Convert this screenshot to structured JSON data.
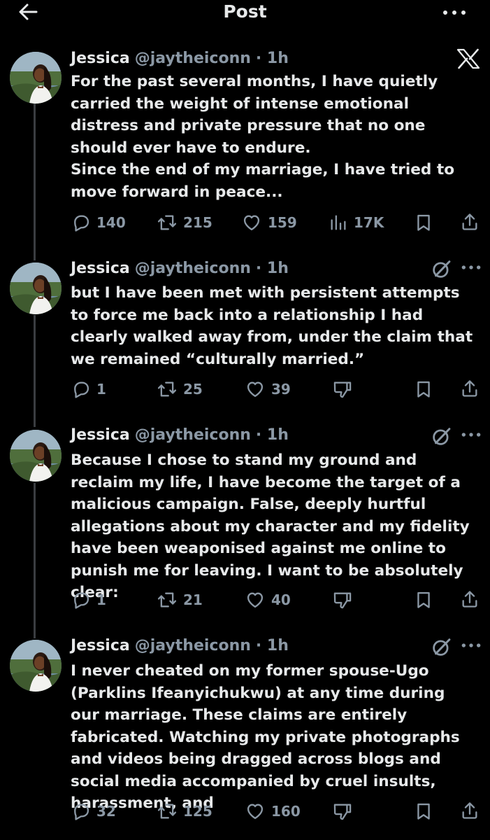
{
  "header": {
    "title": "Post"
  },
  "posts": [
    {
      "name": "Jessica",
      "handle": "@jaytheiconn",
      "time": "· 1h",
      "text": [
        "For the past several months, I have quietly carried the weight of intense emotional distress and private pressure that no one should ever have to endure.",
        "Since the end of my marriage, I have tried to move forward in peace..."
      ],
      "replies": "140",
      "reposts": "215",
      "likes": "159",
      "views": "17K"
    },
    {
      "name": "Jessica",
      "handle": "@jaytheiconn",
      "time": "· 1h",
      "text": [
        "but I have been met with persistent attempts to force me back into a relationship I had clearly walked away from, under the claim that we remained “culturally married.”"
      ],
      "replies": "1",
      "reposts": "25",
      "likes": "39"
    },
    {
      "name": "Jessica",
      "handle": "@jaytheiconn",
      "time": "· 1h",
      "text": [
        "Because I chose to stand my ground and reclaim my life, I have become the target of a malicious campaign. False, deeply hurtful allegations about my character and my fidelity have been weaponised against me online to punish me for leaving. I want to be absolutely clear:"
      ],
      "replies": "1",
      "reposts": "21",
      "likes": "40"
    },
    {
      "name": "Jessica",
      "handle": "@jaytheiconn",
      "time": "· 1h",
      "text": [
        "I never cheated on my former spouse-Ugo (Parklins Ifeanyichukwu) at any time during our marriage. These claims are entirely fabricated. Watching my private photographs and videos being dragged across blogs and social media accompanied by cruel insults, harassment, and"
      ],
      "replies": "32",
      "reposts": "125",
      "likes": "160"
    }
  ],
  "icons": {
    "back": "arrow-left-icon",
    "more": "more-horizontal-icon",
    "x_logo": "x-logo-icon",
    "grok": "grok-icon",
    "reply": "reply-icon",
    "repost": "repost-icon",
    "like": "heart-icon",
    "views": "views-icon",
    "dislike": "dislike-icon",
    "bookmark": "bookmark-icon",
    "share": "share-icon"
  },
  "colors": {
    "background": "#000000",
    "text": "#e7e9ea",
    "muted": "#8b98a5",
    "thread_line": "#3a3d41"
  }
}
